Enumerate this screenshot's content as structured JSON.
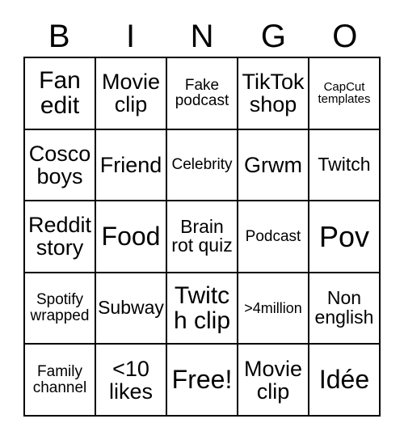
{
  "card": {
    "title": "BINGO",
    "header_letters": [
      "B",
      "I",
      "N",
      "G",
      "O"
    ],
    "grid_size": "5x5",
    "colors": {
      "background": "#ffffff",
      "border": "#000000",
      "text": "#000000"
    },
    "rows": [
      [
        {
          "text": "Fan edit",
          "size": "fs-2xl"
        },
        {
          "text": "Movie clip",
          "size": "fs-xl"
        },
        {
          "text": "Fake podcast",
          "size": "fs-md"
        },
        {
          "text": "TikTok shop",
          "size": "fs-xl"
        },
        {
          "text": "CapCut templates",
          "size": "fs-xs"
        }
      ],
      [
        {
          "text": "Cosco boys",
          "size": "fs-xl"
        },
        {
          "text": "Friend",
          "size": "fs-xl"
        },
        {
          "text": "Celebrity",
          "size": "fs-md"
        },
        {
          "text": "Grwm",
          "size": "fs-xl"
        },
        {
          "text": "Twitch",
          "size": "fs-lg"
        }
      ],
      [
        {
          "text": "Reddit story",
          "size": "fs-xl"
        },
        {
          "text": "Food",
          "size": "fs-3xl"
        },
        {
          "text": "Brain rot quiz",
          "size": "fs-lg"
        },
        {
          "text": "Podcast",
          "size": "fs-md"
        },
        {
          "text": "Pov",
          "size": "fs-4xl"
        }
      ],
      [
        {
          "text": "Spotify wrapped",
          "size": "fs-md"
        },
        {
          "text": "Subway",
          "size": "fs-lg"
        },
        {
          "text": "Twitch clip",
          "size": "fs-2xl"
        },
        {
          "text": ">4million",
          "size": "fs-sm"
        },
        {
          "text": "Non english",
          "size": "fs-lg"
        }
      ],
      [
        {
          "text": "Family channel",
          "size": "fs-md"
        },
        {
          "text": "<10 likes",
          "size": "fs-xl"
        },
        {
          "text": "Free!",
          "size": "fs-3xl"
        },
        {
          "text": "Movie clip",
          "size": "fs-xl"
        },
        {
          "text": "Idée",
          "size": "fs-3xl"
        }
      ]
    ]
  }
}
